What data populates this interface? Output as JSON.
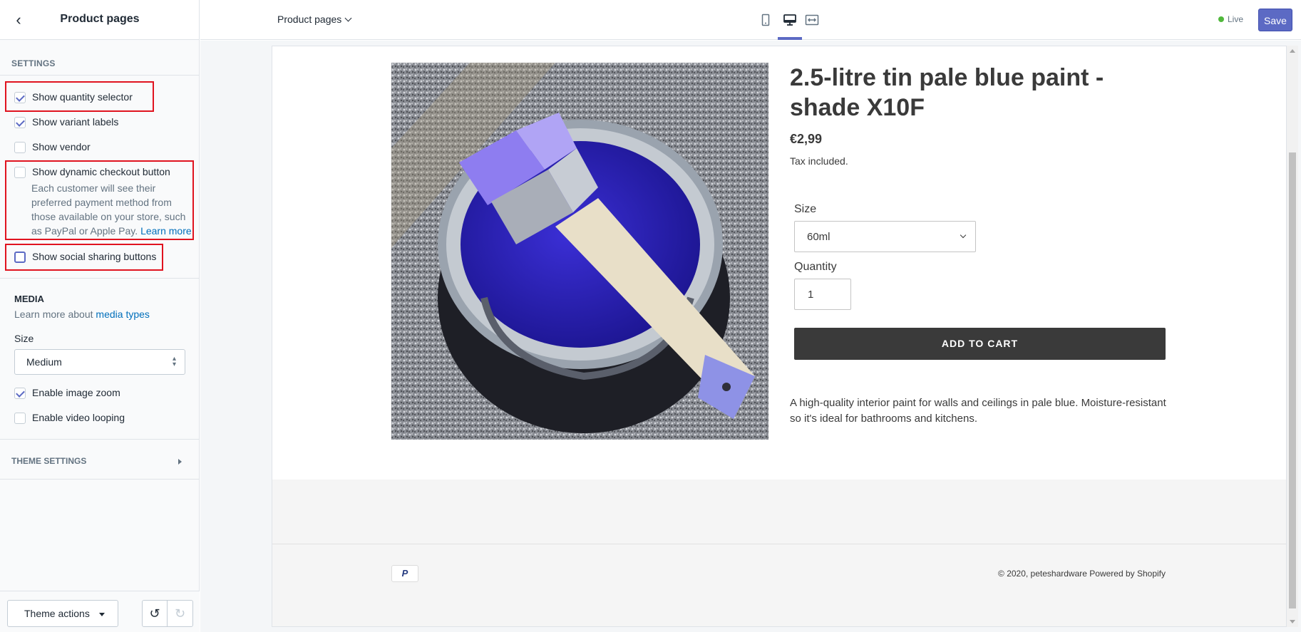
{
  "sidebar": {
    "back_icon": "chevron-left-icon",
    "title": "Product pages",
    "settings_heading": "SETTINGS",
    "options": [
      {
        "label": "Show quantity selector",
        "checked": true
      },
      {
        "label": "Show variant labels",
        "checked": true
      },
      {
        "label": "Show vendor",
        "checked": false
      },
      {
        "label": "Show dynamic checkout button",
        "checked": false
      },
      {
        "label": "Show social sharing buttons",
        "checked": false
      }
    ],
    "dynamic_help": "Each customer will see their preferred payment method from those available on your store, such as PayPal or Apple Pay.",
    "dynamic_help_link": "Learn more",
    "media": {
      "heading": "MEDIA",
      "sub_text": "Learn more about",
      "sub_link": "media types",
      "size_label": "Size",
      "size_value": "Medium",
      "options": [
        {
          "label": "Enable image zoom",
          "checked": true
        },
        {
          "label": "Enable video looping",
          "checked": false
        }
      ]
    },
    "theme_settings": "THEME SETTINGS",
    "theme_actions": "Theme actions"
  },
  "topbar": {
    "page_selector": "Product pages",
    "views": [
      "mobile-icon",
      "desktop-icon",
      "full-width-icon"
    ],
    "active_view": "desktop-icon",
    "status": "Live",
    "status_color": "#50b83c",
    "save_label": "Save",
    "accent": "#5c6ac4"
  },
  "product": {
    "title": "2.5-litre tin pale blue paint - shade X10F",
    "price": "€2,99",
    "tax_note": "Tax included.",
    "size_label": "Size",
    "size_value": "60ml",
    "quantity_label": "Quantity",
    "quantity_value": "1",
    "add_to_cart": "ADD TO CART",
    "description": "A high-quality interior paint for walls and ceilings in pale blue. Moisture-resistant so it's ideal for bathrooms and kitchens."
  },
  "footer": {
    "payment_icon": "paypal-icon",
    "paypal_mark": "P",
    "copyright": "© 2020, peteshardware Powered by Shopify"
  }
}
